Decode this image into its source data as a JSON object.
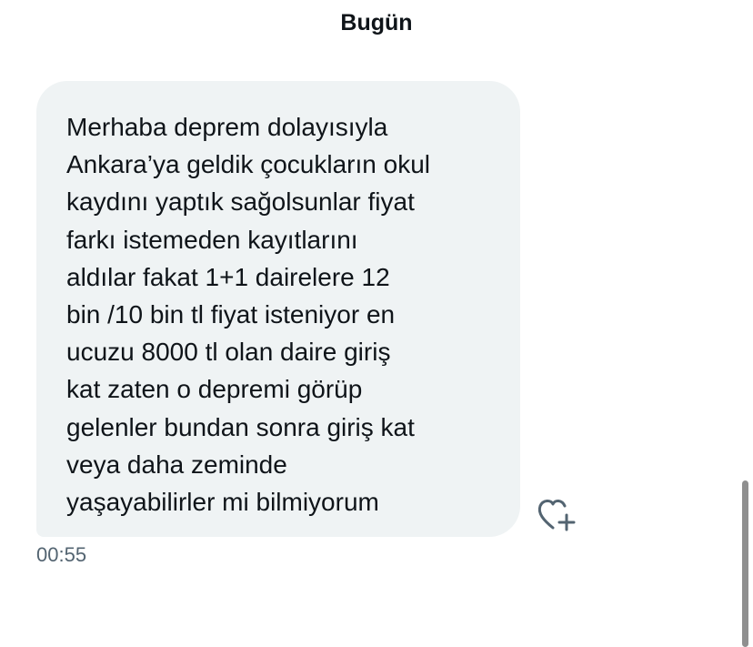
{
  "conversation": {
    "date_header": "Bugün",
    "message": {
      "text": "Merhaba deprem dolayısıyla\nAnkara’ya geldik çocukların okul\nkaydını yaptık sağolsunlar fiyat\nfarkı istemeden kayıtlarını\naldılar fakat 1+1 dairelere 12\nbin /10 bin tl fiyat isteniyor en\nucuzu 8000 tl olan daire giriş\nkat zaten o depremi görüp\ngelenler bundan sonra giriş kat\nveya daha zeminde\nyaşayabilirler mi bilmiyorum",
      "timestamp": "00:55",
      "reaction_icon": "heart-plus-icon"
    }
  },
  "colors": {
    "bubble_background": "#eff3f4",
    "text": "#0f1419",
    "timestamp": "#536471",
    "icon": "#536471"
  }
}
